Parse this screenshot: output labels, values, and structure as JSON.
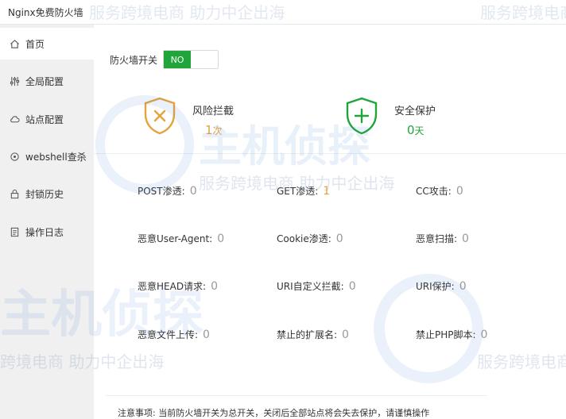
{
  "window": {
    "title": "Nginx免费防火墙"
  },
  "sidebar": {
    "items": [
      {
        "label": "首页",
        "icon": "home-icon"
      },
      {
        "label": "全局配置",
        "icon": "sliders-icon"
      },
      {
        "label": "站点配置",
        "icon": "cloud-icon"
      },
      {
        "label": "webshell查杀",
        "icon": "target-icon"
      },
      {
        "label": "封锁历史",
        "icon": "lock-icon"
      },
      {
        "label": "操作日志",
        "icon": "document-icon"
      }
    ]
  },
  "firewall_switch": {
    "label": "防火墙开关",
    "state_label": "NO",
    "accent": "#20a53a"
  },
  "stats": {
    "risk": {
      "name": "风险拦截",
      "value": "1",
      "unit": "次",
      "color": "#e6a23c"
    },
    "safe": {
      "name": "安全保护",
      "value": "0",
      "unit": "天",
      "color": "#20a53a"
    }
  },
  "counters": [
    {
      "label": "POST渗透:",
      "value": "0"
    },
    {
      "label": "GET渗透:",
      "value": "1"
    },
    {
      "label": "CC攻击:",
      "value": "0"
    },
    {
      "label": "恶意User-Agent:",
      "value": "0"
    },
    {
      "label": "Cookie渗透:",
      "value": "0"
    },
    {
      "label": "恶意扫描:",
      "value": "0"
    },
    {
      "label": "恶意HEAD请求:",
      "value": "0"
    },
    {
      "label": "URI自定义拦截:",
      "value": "0"
    },
    {
      "label": "URI保护:",
      "value": "0"
    },
    {
      "label": "恶意文件上传:",
      "value": "0"
    },
    {
      "label": "禁止的扩展名:",
      "value": "0"
    },
    {
      "label": "禁止PHP脚本:",
      "value": "0"
    }
  ],
  "note": "注意事项: 当前防火墙开关为总开关，关闭后全部站点将会失去保护，请谨慎操作",
  "watermark": {
    "brand": "主机侦探",
    "line1": "服务跨境电商 助力中企出海",
    "line2": "服务跨境电商",
    "line3": "跨境电商 助力中企出海",
    "line4": "明电商 助力中企出海"
  }
}
